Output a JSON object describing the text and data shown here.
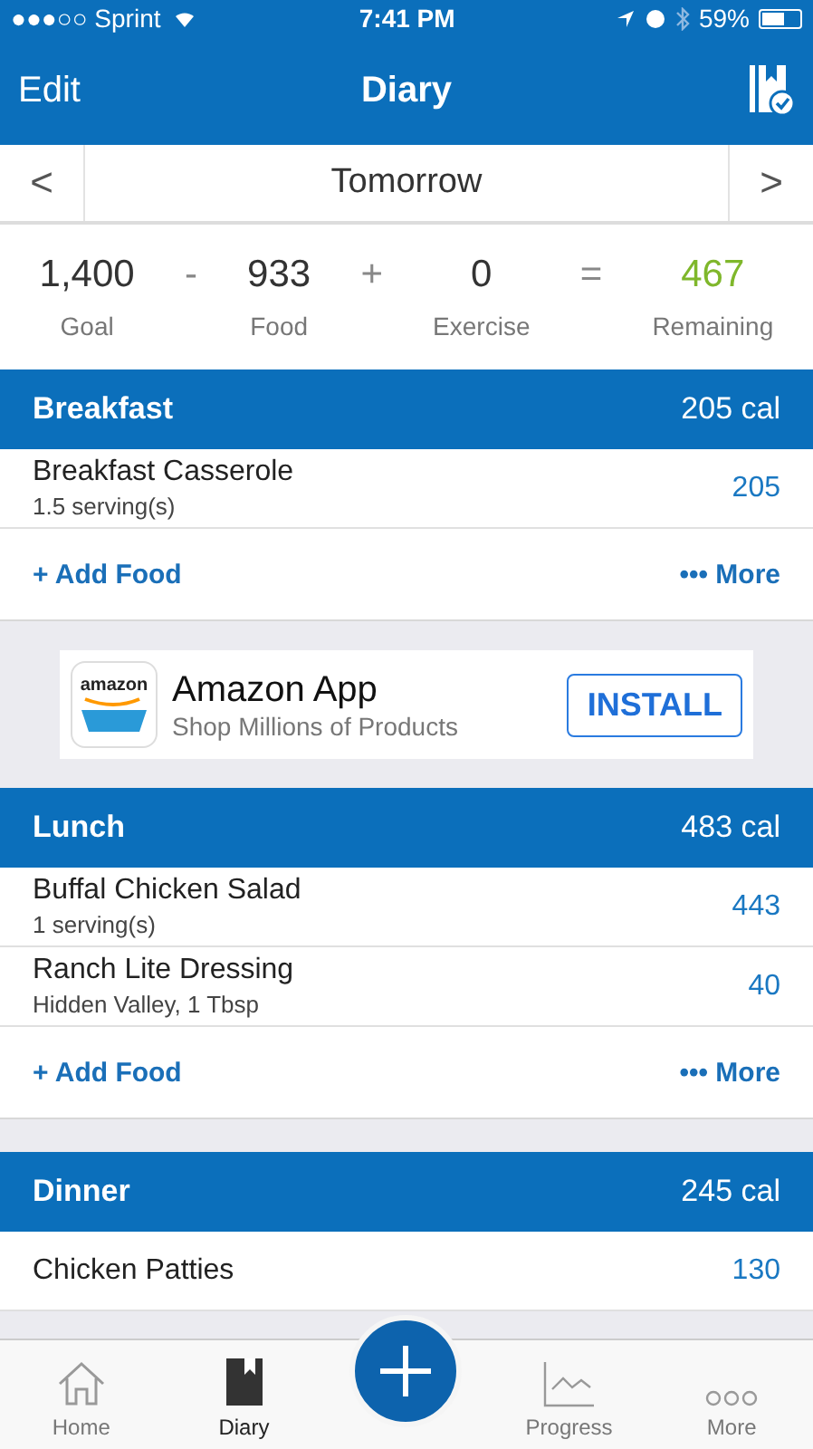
{
  "status_bar": {
    "carrier": "●●●○○ Sprint",
    "time": "7:41 PM",
    "battery": "59%"
  },
  "nav": {
    "left": "Edit",
    "title": "Diary"
  },
  "date_bar": {
    "prev": "<",
    "label": "Tomorrow",
    "next": ">"
  },
  "summary": [
    {
      "value": "1,400",
      "label": "Goal",
      "kind": "term"
    },
    {
      "value": "-",
      "kind": "op"
    },
    {
      "value": "933",
      "label": "Food",
      "kind": "term"
    },
    {
      "value": "+",
      "kind": "op"
    },
    {
      "value": "0",
      "label": "Exercise",
      "kind": "term"
    },
    {
      "value": "=",
      "kind": "op"
    },
    {
      "value": "467",
      "label": "Remaining",
      "kind": "result"
    }
  ],
  "sections": [
    {
      "kind": "meal",
      "name": "Breakfast",
      "calories": "205 cal",
      "items": [
        {
          "name": "Breakfast Casserole",
          "detail": "1.5 serving(s)",
          "calories": "205"
        }
      ],
      "add": "+ Add Food",
      "more": "••• More"
    },
    {
      "kind": "ad",
      "title": "Amazon App",
      "subtitle": "Shop Millions of Products",
      "logo": "amazon",
      "button": "INSTALL"
    },
    {
      "kind": "meal",
      "name": "Lunch",
      "calories": "483 cal",
      "items": [
        {
          "name": "Buffal Chicken  Salad",
          "detail": "1 serving(s)",
          "calories": "443"
        },
        {
          "name": "Ranch Lite Dressing",
          "detail": "Hidden Valley, 1 Tbsp",
          "calories": "40"
        }
      ],
      "add": "+ Add Food",
      "more": "••• More"
    },
    {
      "kind": "meal",
      "name": "Dinner",
      "calories": "245 cal",
      "items": [
        {
          "name": "Chicken Patties",
          "calories": "130"
        }
      ]
    }
  ],
  "tab_bar": [
    {
      "label": "Home",
      "kind": "tab",
      "selected": false
    },
    {
      "label": "Diary",
      "kind": "tab",
      "selected": true
    },
    {
      "kind": "fab"
    },
    {
      "label": "Progress",
      "kind": "tab",
      "selected": false
    },
    {
      "label": "More",
      "kind": "tab",
      "selected": false
    }
  ]
}
